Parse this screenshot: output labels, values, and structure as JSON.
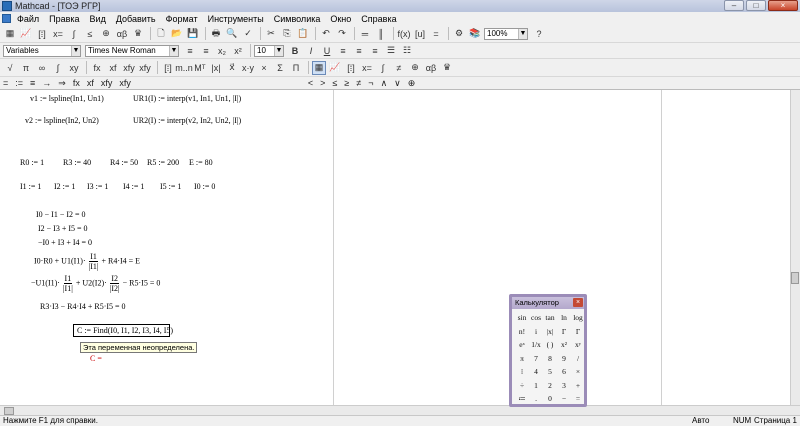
{
  "window": {
    "title": "Mathcad - [ТОЭ РГР]",
    "controls": [
      "–",
      "□",
      "×"
    ]
  },
  "menu": [
    "Файл",
    "Правка",
    "Вид",
    "Добавить",
    "Формат",
    "Инструменты",
    "Символика",
    "Окно",
    "Справка"
  ],
  "format_toolbar": {
    "style": "Variables",
    "font": "Times New Roman",
    "size": "10"
  },
  "standard_toolbar": {
    "zoom": "100%"
  },
  "operators_bar": [
    "=",
    ":=",
    "≡",
    "→",
    "⇒",
    "fx",
    "xf",
    "xfy",
    "xfy",
    "<",
    ">",
    "≤",
    "≥",
    "≠",
    "¬",
    "∧",
    "∨",
    "⊕"
  ],
  "worksheet": {
    "l1a": "v1 := lspline(In1, Un1)",
    "l1b": "UR1(I) := interp(v1, In1, Un1, |I|)",
    "l2a": "v2 := lspline(In2, Un2)",
    "l2b": "UR2(I) := interp(v2, In2, Un2, |I|)",
    "r0": "R0 := 1",
    "r3": "R3 := 40",
    "r4": "R4 := 50",
    "r5": "R5 := 200",
    "e": "E := 80",
    "i1": "I1 := 1",
    "i2": "I2 := 1",
    "i3": "I3 := 1",
    "i4": "I4 := 1",
    "i5": "I5 := 1",
    "i0": "I0 := 0",
    "eq1": "I0 − I1 − I2 = 0",
    "eq2": "I2 − I3 + I5 = 0",
    "eq3": "−I0 + I3 + I4 = 0",
    "eq4_pre": "I0·R0 + U1(I1)·",
    "eq4_num": "I1",
    "eq4_den": "|I1|",
    "eq4_post": "+ R4·I4 = E",
    "eq5_pre": "−U1(I1)·",
    "eq5_num1": "I1",
    "eq5_den1": "|I1|",
    "eq5_mid": "+ U2(I2)·",
    "eq5_num2": "I2",
    "eq5_den2": "|I2|",
    "eq5_post": "− R5·I5 = 0",
    "eq6": "R3·I3 − R4·I4 + R5·I5 = 0",
    "find": "C := Find(I0, I1, I2, I3, I4, I5)",
    "tooltip": "Эта переменная неопределена.",
    "eval": "C ="
  },
  "calculator": {
    "title": "Калькулятор",
    "keys": [
      "sin",
      "cos",
      "tan",
      "ln",
      "log",
      "n!",
      "i",
      "|x|",
      "Γ",
      "Γ",
      "eˣ",
      "1/x",
      "( )",
      "x²",
      "xʸ",
      "π",
      "7",
      "8",
      "9",
      "/",
      "⁞",
      "4",
      "5",
      "6",
      "×",
      "÷",
      "1",
      "2",
      "3",
      "+",
      "≔",
      ".",
      "0",
      "−",
      "="
    ]
  },
  "status": {
    "hint": "Нажмите F1 для справки.",
    "mode": "Авто",
    "num": "NUM",
    "page": "Страница 1"
  }
}
